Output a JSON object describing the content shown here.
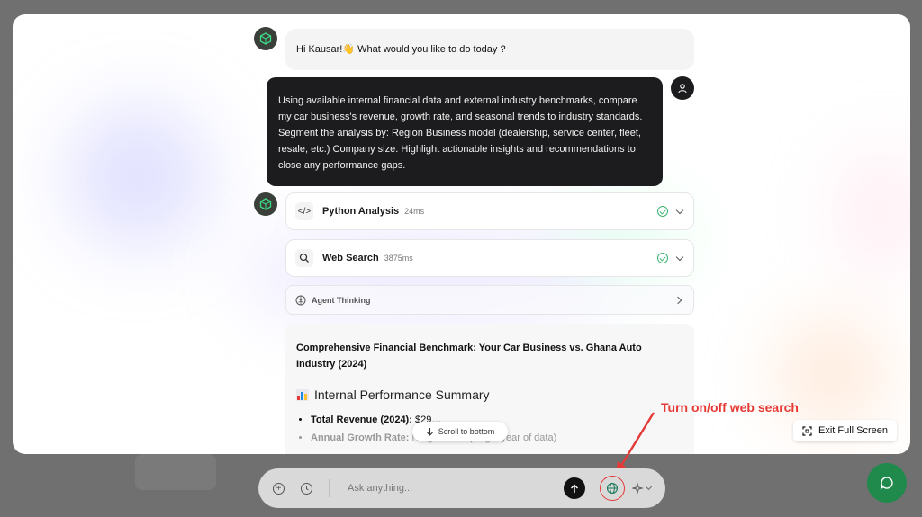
{
  "greeting": {
    "text": "Hi Kausar!👋 What would you like to do today ?"
  },
  "user_message": {
    "text": "Using available internal financial data and external industry benchmarks, compare my car business's revenue, growth rate, and seasonal trends to industry standards. Segment the analysis by: Region Business model (dealership, service center, fleet, resale, etc.) Company size. Highlight actionable insights and recommendations to close any performance gaps."
  },
  "tools": [
    {
      "name": "Python Analysis",
      "duration": "24ms",
      "icon": "code-icon"
    },
    {
      "name": "Web Search",
      "duration": "3875ms",
      "icon": "search-icon"
    }
  ],
  "thinking": {
    "label": "Agent Thinking"
  },
  "report": {
    "title": "Comprehensive Financial Benchmark: Your Car Business vs. Ghana Auto Industry (2024)",
    "heading": "Internal Performance Summary",
    "items": [
      {
        "label": "Total Revenue (2024):",
        "value": "$29…"
      },
      {
        "label": "Annual Growth Rate:",
        "value": "No g… …ed (single year of data)"
      }
    ]
  },
  "scroll_button": {
    "label": "Scroll to bottom"
  },
  "exit_button": {
    "label": "Exit Full Screen"
  },
  "annotation": {
    "text": "Turn on/off web search",
    "color": "#e53935"
  },
  "input": {
    "placeholder": "Ask anything..."
  },
  "colors": {
    "accent_green": "#1f8a4c",
    "user_bubble": "#1c1c1e"
  }
}
